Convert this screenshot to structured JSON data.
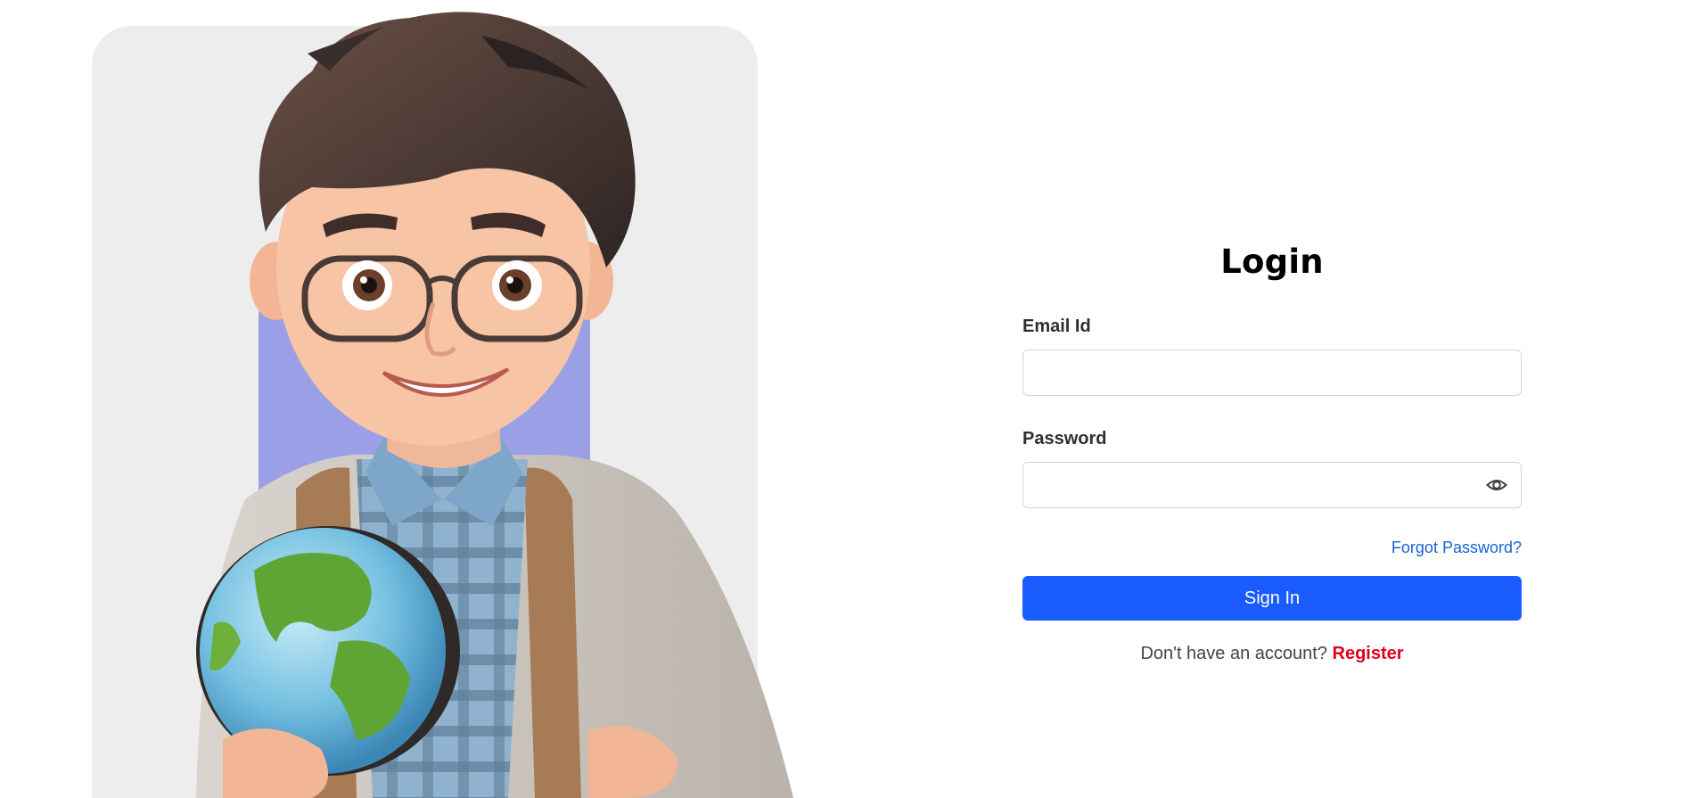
{
  "login": {
    "title": "Login",
    "email_label": "Email Id",
    "email_value": "",
    "password_label": "Password",
    "password_value": "",
    "show_password_icon": "eye-icon",
    "forgot_password": "Forgot Password?",
    "sign_in": "Sign In",
    "no_account_text": "Don't have an account?",
    "register": "Register"
  },
  "colors": {
    "primary": "#1a5cff",
    "link": "#1763d9",
    "register": "#e2001a",
    "hero_background": "#ededed",
    "hero_accent": "#9a9fe6"
  }
}
